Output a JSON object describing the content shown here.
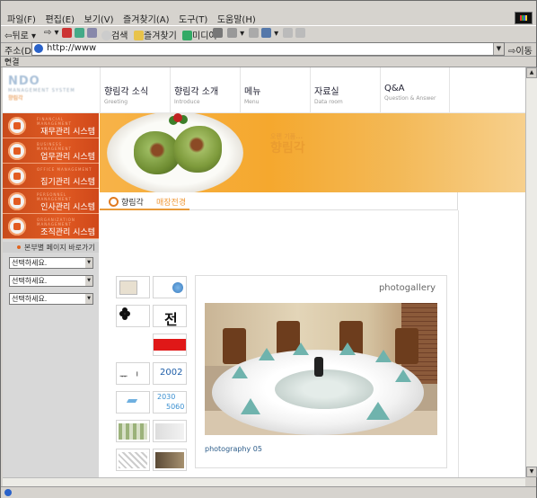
{
  "browser": {
    "menu": [
      "파일(F)",
      "편집(E)",
      "보기(V)",
      "즐겨찾기(A)",
      "도구(T)",
      "도움말(H)"
    ],
    "toolbar": {
      "back": "뒤로",
      "search": "검색",
      "favorites": "즐겨찾기",
      "media": "미디어"
    },
    "address_label": "주소(D)",
    "address_value": "http://www",
    "go_label": "이동",
    "links_label": "연결"
  },
  "site": {
    "nav": [
      {
        "title": "향림각 소식",
        "sub": "Greeting"
      },
      {
        "title": "향림각 소개",
        "sub": "Introduce"
      },
      {
        "title": "메뉴",
        "sub": "Menu"
      },
      {
        "title": "자료실",
        "sub": "Data room"
      },
      {
        "title": "Q&A",
        "sub": "Question & Answer"
      }
    ],
    "side_menu": [
      {
        "label": "재무관리 시스템"
      },
      {
        "label": "업무관리 시스템"
      },
      {
        "label": "집기관리 시스템"
      },
      {
        "label": "인사관리 시스템"
      },
      {
        "label": "조직관리 시스템"
      }
    ],
    "shortcut_label": "본부별 페이지 바로가기",
    "selects": [
      "선택하세요.",
      "선택하세요.",
      "선택하세요."
    ],
    "section": {
      "title_main": "향림각",
      "title_sub": "매장전경"
    },
    "gallery": {
      "title": "photogallery",
      "caption": "photography 05",
      "thumb_numbers": [
        "2002",
        "2030",
        "5060"
      ]
    },
    "colors": {
      "accent_orange": "#e05a22",
      "banner_orange": "#f5a82e",
      "caption_blue": "#2d5d8a"
    }
  }
}
